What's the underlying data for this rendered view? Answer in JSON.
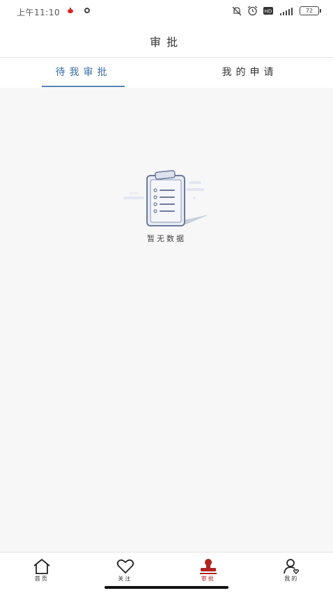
{
  "status_bar": {
    "time": "上午11:10",
    "battery": "72"
  },
  "header": {
    "title": "审批"
  },
  "tabs": [
    {
      "label": "待我审批",
      "active": true
    },
    {
      "label": "我的申请",
      "active": false
    }
  ],
  "empty_state": {
    "message": "暂无数据",
    "icon": "clipboard-illustration"
  },
  "tabbar": {
    "items": [
      {
        "label": "首页",
        "icon": "home-icon"
      },
      {
        "label": "关注",
        "icon": "heart-icon"
      },
      {
        "label": "审批",
        "icon": "stamp-icon",
        "active": true
      },
      {
        "label": "我的",
        "icon": "user-icon"
      }
    ]
  },
  "colors": {
    "accent": "#3a6ea5",
    "active_tab": "#b22222",
    "background": "#f7f7f8"
  }
}
